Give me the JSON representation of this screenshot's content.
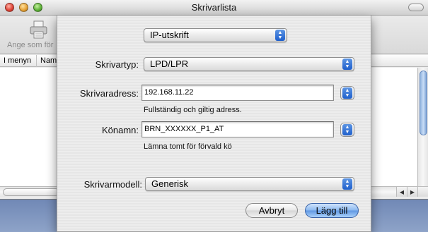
{
  "window": {
    "title": "Skrivarlista"
  },
  "toolbar": {
    "set_default_label": "Ange som för"
  },
  "list": {
    "columns": [
      "I menyn",
      "Nam"
    ]
  },
  "dialog": {
    "connection_type": "IP-utskrift",
    "printer_type_label": "Skrivartyp:",
    "printer_type_value": "LPD/LPR",
    "address_label": "Skrivaradress:",
    "address_value": "192.168.11.22",
    "address_hint": "Fullständig och giltig adress.",
    "queue_label": "Könamn:",
    "queue_value": "BRN_XXXXXX_P1_AT",
    "queue_hint": "Lämna tomt för förvald kö",
    "model_label": "Skrivarmodell:",
    "model_value": "Generisk",
    "cancel_label": "Avbryt",
    "add_label": "Lägg till"
  },
  "colors": {
    "accent": "#1e5fcc",
    "default_button": "#5f97e2"
  }
}
